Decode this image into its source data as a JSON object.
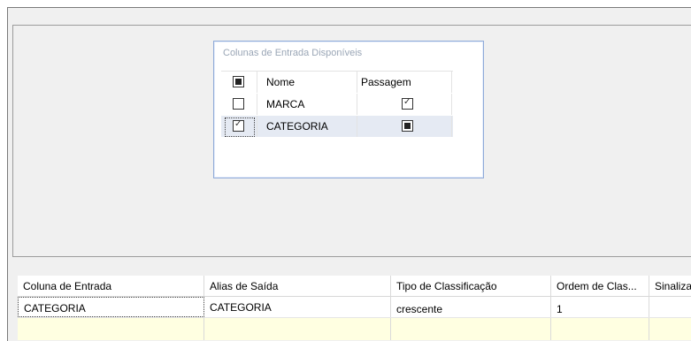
{
  "input_columns": {
    "title": "Colunas de Entrada Disponíveis",
    "headers": [
      "Nome",
      "Passagem"
    ],
    "rows": [
      {
        "name": "MARCA",
        "selected": false,
        "passthrough": "checked"
      },
      {
        "name": "CATEGORIA",
        "selected": true,
        "passthrough": "indeterminate"
      }
    ]
  },
  "grid": {
    "headers": [
      "Coluna de Entrada",
      "Alias de Saída",
      "Tipo de Classificação",
      "Ordem de Clas...",
      "Sinaliza"
    ],
    "rows": [
      [
        "CATEGORIA",
        "CATEGORIA",
        "crescente",
        "1",
        ""
      ]
    ]
  },
  "colors": {
    "panel_border": "#8faad8",
    "selected_row": "#e5eaf3",
    "new_row": "#ffffe1"
  }
}
